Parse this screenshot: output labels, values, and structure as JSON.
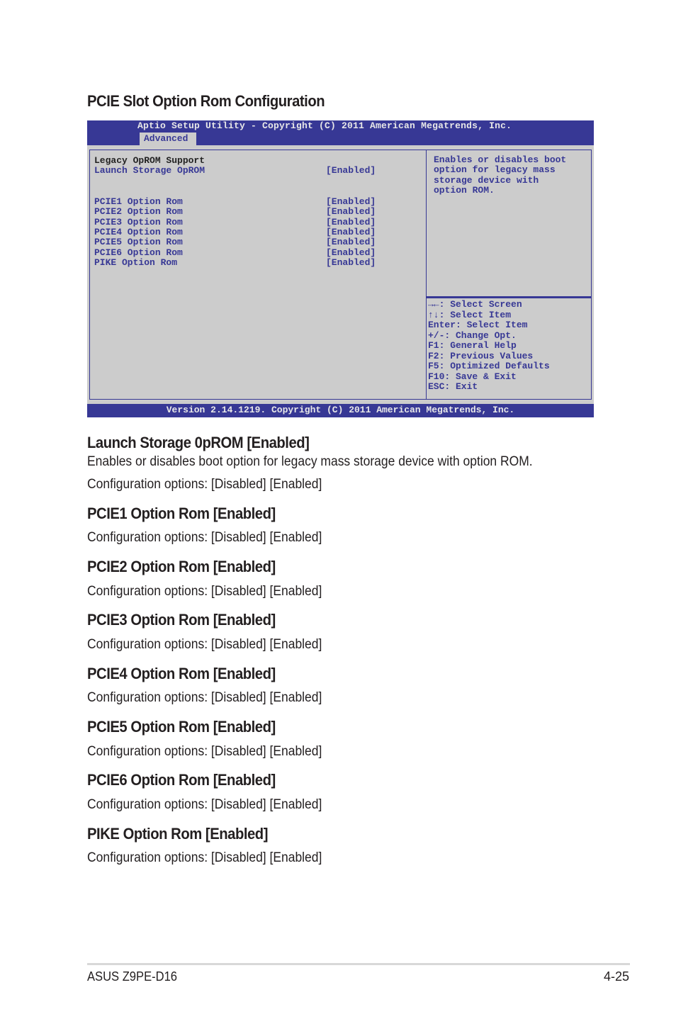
{
  "section_title": "PCIE Slot Option Rom Configuration",
  "bios": {
    "header_title": "Aptio Setup Utility - Copyright (C) 2011 American Megatrends, Inc.",
    "active_tab": "Advanced",
    "heading": "Legacy OpROM Support",
    "items": [
      {
        "label": "Launch Storage OpROM",
        "value": "[Enabled]"
      },
      {
        "label": "PCIE1 Option Rom",
        "value": "[Enabled]"
      },
      {
        "label": "PCIE2 Option Rom",
        "value": "[Enabled]"
      },
      {
        "label": "PCIE3 Option Rom",
        "value": "[Enabled]"
      },
      {
        "label": "PCIE4 Option Rom",
        "value": "[Enabled]"
      },
      {
        "label": "PCIE5 Option Rom",
        "value": "[Enabled]"
      },
      {
        "label": "PCIE6 Option Rom",
        "value": "[Enabled]"
      },
      {
        "label": "PIKE Option Rom",
        "value": "[Enabled]"
      }
    ],
    "help_lines": [
      "Enables or disables boot",
      "option for legacy mass",
      "storage device with",
      "option ROM."
    ],
    "key_lines": [
      "→←: Select Screen",
      "↑↓:  Select Item",
      "Enter: Select Item",
      "+/-: Change Opt.",
      "F1: General Help",
      "F2: Previous Values",
      "F5: Optimized Defaults",
      "F10: Save & Exit",
      "ESC: Exit"
    ],
    "footer": "Version 2.14.1219. Copyright (C) 2011 American Megatrends, Inc."
  },
  "sections": [
    {
      "title": "Launch Storage 0pROM [Enabled]",
      "desc": "Enables or disables boot option for legacy mass storage device with option ROM.",
      "options": "Configuration options: [Disabled] [Enabled]"
    },
    {
      "title": "PCIE1 Option Rom [Enabled]",
      "options": "Configuration options: [Disabled] [Enabled]"
    },
    {
      "title": "PCIE2 Option Rom [Enabled]",
      "options": "Configuration options: [Disabled] [Enabled]"
    },
    {
      "title": "PCIE3 Option Rom [Enabled]",
      "options": "Configuration options: [Disabled] [Enabled]"
    },
    {
      "title": "PCIE4 Option Rom [Enabled]",
      "options": "Configuration options: [Disabled] [Enabled]"
    },
    {
      "title": "PCIE5 Option Rom [Enabled]",
      "options": "Configuration options: [Disabled] [Enabled]"
    },
    {
      "title": "PCIE6 Option Rom [Enabled]",
      "options": "Configuration options: [Disabled] [Enabled]"
    },
    {
      "title": "PIKE Option Rom [Enabled]",
      "options": "Configuration options: [Disabled] [Enabled]"
    }
  ],
  "footer": {
    "left": "ASUS Z9PE-D16",
    "right": "4-25"
  }
}
